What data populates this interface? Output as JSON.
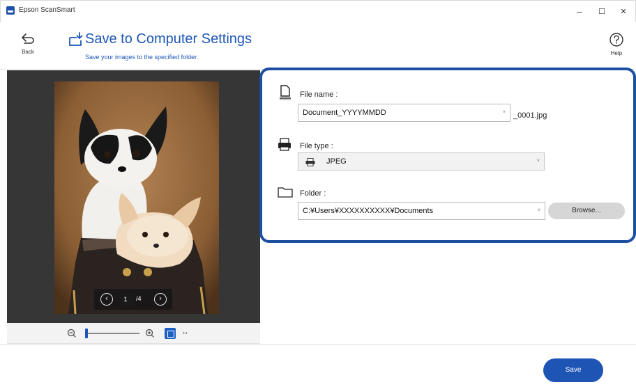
{
  "window": {
    "title": "Epson ScanSmart",
    "minimize": "–",
    "maximize": "☐",
    "close": "✕"
  },
  "header": {
    "back_label": "Back",
    "title": "Save to Computer Settings",
    "subtitle": "Save your images to the specified folder.",
    "help_label": "Help"
  },
  "preview": {
    "current_page": "1",
    "total_pages": "/4"
  },
  "settings": {
    "file_name_label": "File name :",
    "file_name_value": "Document_YYYYMMDD",
    "file_name_suffix": "_0001.jpg",
    "file_type_label": "File type :",
    "file_type_value": "JPEG",
    "folder_label": "Folder :",
    "folder_value": "C:¥Users¥XXXXXXXXXX¥Documents",
    "browse_label": "Browse..."
  },
  "footer": {
    "save_label": "Save"
  },
  "colors": {
    "accent": "#1d57b6",
    "panel_border": "#1c4fa0",
    "preview_bg": "#363636"
  }
}
